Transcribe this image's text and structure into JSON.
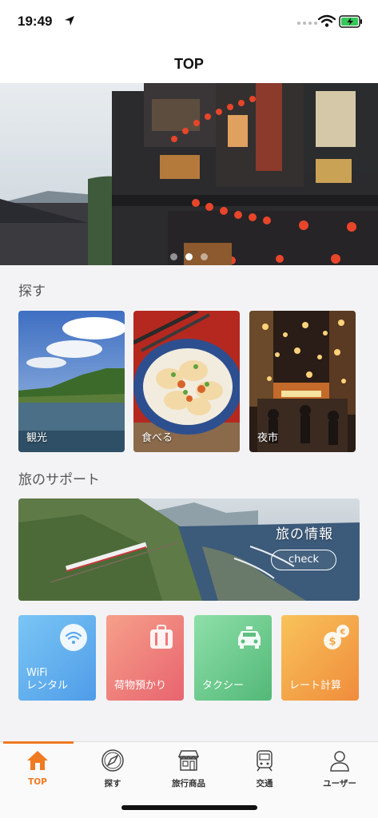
{
  "status_bar": {
    "time": "19:49"
  },
  "navbar": {
    "title": "TOP"
  },
  "hero": {
    "slide_count": 3,
    "active_slide": 2
  },
  "explore": {
    "title": "探す",
    "categories": [
      {
        "label": "観光",
        "image": "lake-landscape"
      },
      {
        "label": "食べる",
        "image": "dumplings"
      },
      {
        "label": "夜市",
        "image": "night-market"
      }
    ]
  },
  "support": {
    "title": "旅のサポート",
    "banner": {
      "title": "旅の情報",
      "button": "check"
    },
    "tiles": [
      {
        "label_line1": "WiFi",
        "label_line2": "レンタル",
        "icon": "wifi-icon",
        "color": "#5fb0f2"
      },
      {
        "label_line1": "",
        "label_line2": "荷物預かり",
        "icon": "luggage-icon",
        "color": "#ee7d7a"
      },
      {
        "label_line1": "",
        "label_line2": "タクシー",
        "icon": "taxi-icon",
        "color": "#6cc98a"
      },
      {
        "label_line1": "",
        "label_line2": "レート計算",
        "icon": "currency-icon",
        "color": "#f2a94a"
      }
    ]
  },
  "tabbar": {
    "accent": "#f07a22",
    "items": [
      {
        "label": "TOP",
        "icon": "home-icon",
        "active": true
      },
      {
        "label": "探す",
        "icon": "compass-icon",
        "active": false
      },
      {
        "label": "旅行商品",
        "icon": "shop-icon",
        "active": false
      },
      {
        "label": "交通",
        "icon": "train-icon",
        "active": false
      },
      {
        "label": "ユーザー",
        "icon": "user-icon",
        "active": false
      }
    ]
  }
}
